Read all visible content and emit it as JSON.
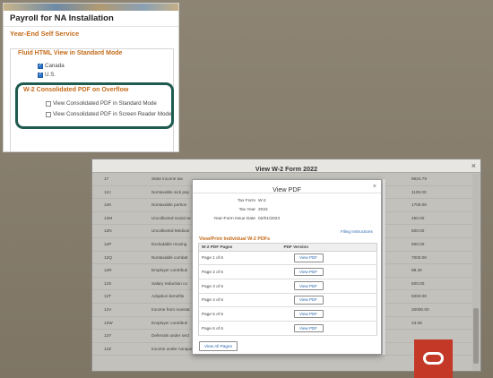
{
  "config_panel": {
    "title": "Payroll for NA Installation",
    "section": "Year-End Self Service",
    "fluid_group": {
      "title": "Fluid HTML View in Standard Mode",
      "options": [
        {
          "label": "Canada",
          "checked": true
        },
        {
          "label": "U.S.",
          "checked": true
        }
      ]
    },
    "overflow_group": {
      "title": "W-2 Consolidated PDF on Overflow",
      "options": [
        {
          "label": "View Consolidated PDF in Standard Mode",
          "checked": false
        },
        {
          "label": "View Consolidated PDF in Screen Reader Mode",
          "checked": false
        }
      ]
    }
  },
  "main_window": {
    "title": "View W-2 Form 2022",
    "close_glyph": "×",
    "rows": [
      {
        "code": "17",
        "desc": "State income tax",
        "amt": "9624.79"
      },
      {
        "code": "12J",
        "desc": "Nontaxable sick pay",
        "amt": "1100.00"
      },
      {
        "code": "12K",
        "desc": "Nontaxable portion",
        "amt": "1700.00"
      },
      {
        "code": "12M",
        "desc": "Uncollected social se",
        "amt": "450.00"
      },
      {
        "code": "12N",
        "desc": "Uncollected Medicar",
        "amt": "500.00"
      },
      {
        "code": "12P",
        "desc": "Excludable moving",
        "amt": "500.00"
      },
      {
        "code": "12Q",
        "desc": "Nontaxable combat",
        "amt": "7000.00"
      },
      {
        "code": "12R",
        "desc": "Employer contributi",
        "amt": "98.30"
      },
      {
        "code": "12S",
        "desc": "Salary reduction co",
        "amt": "500.00"
      },
      {
        "code": "12T",
        "desc": "Adoption benefits",
        "amt": "5000.00"
      },
      {
        "code": "12V",
        "desc": "Income from nonstat",
        "amt": "20000.00"
      },
      {
        "code": "12W",
        "desc": "Employer contributi",
        "amt": "33.08"
      },
      {
        "code": "12Y",
        "desc": "Deferrals under sect",
        "amt": ""
      },
      {
        "code": "12Z",
        "desc": "Income under nonqualified compensation plan",
        "amt": ""
      }
    ]
  },
  "modal": {
    "title": "View PDF",
    "close_glyph": "×",
    "info": [
      {
        "label": "Tax Form",
        "value": "W-2"
      },
      {
        "label": "Tax Year",
        "value": "2022"
      },
      {
        "label": "Year-Form Issue Date",
        "value": "02/01/2023"
      }
    ],
    "filing_link": "Filing Instructions",
    "section_title": "View/Print Individual W-2 PDFs",
    "table_headers": {
      "pages": "W-2 PDF Pages",
      "version": "PDF Version"
    },
    "pages": [
      {
        "label": "Page 1 of 6",
        "button": "View PDF"
      },
      {
        "label": "Page 2 of 6",
        "button": "View PDF"
      },
      {
        "label": "Page 3 of 6",
        "button": "View PDF"
      },
      {
        "label": "Page 4 of 6",
        "button": "View PDF"
      },
      {
        "label": "Page 5 of 6",
        "button": "View PDF"
      },
      {
        "label": "Page 6 of 6",
        "button": "View PDF"
      }
    ],
    "view_all_label": "View All Pages"
  },
  "colors": {
    "section_orange": "#c46b1a",
    "highlight_ring": "#1f5b4e",
    "oracle_red": "#c33827",
    "link_blue": "#2b68b0"
  },
  "icons": {
    "oracle_logo": "oracle-logo-icon",
    "close": "close-icon",
    "checkbox": "checkbox-icon"
  }
}
